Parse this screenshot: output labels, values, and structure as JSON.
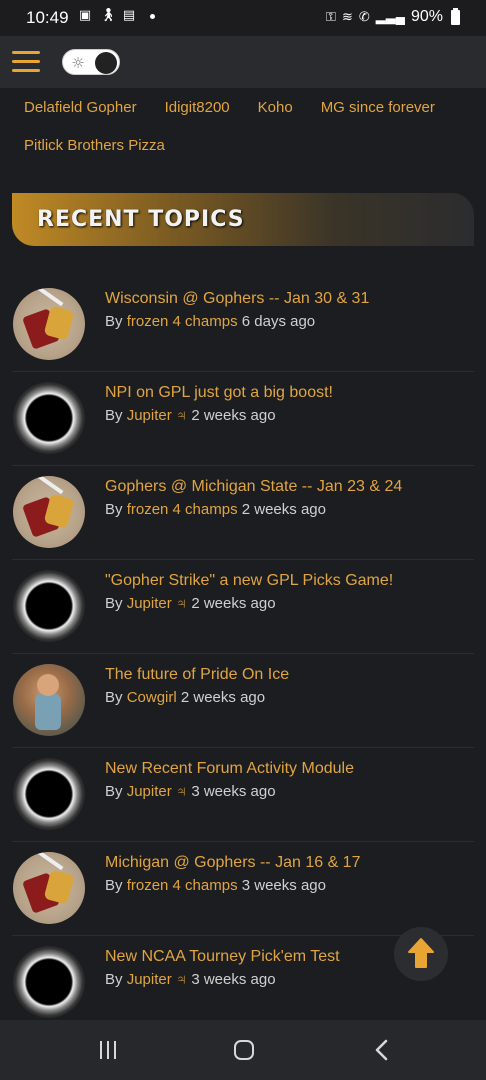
{
  "status_bar": {
    "time": "10:49",
    "battery": "90%"
  },
  "header": {
    "menu_icon": "hamburger-menu-icon",
    "theme_toggle_icon": "sun-icon"
  },
  "top_links": [
    [
      "Delafield Gopher",
      "Idigit8200",
      "Koho",
      "MG since forever"
    ],
    [
      "Pitlick Brothers Pizza"
    ]
  ],
  "recent_topics": {
    "heading": "RECENT TOPICS",
    "items": [
      {
        "title": "Wisconsin @ Gophers -- Jan 30 & 31",
        "by": "By",
        "author": "frozen 4 champs",
        "time": "6 days ago",
        "avatar": "gopher"
      },
      {
        "title": "NPI on GPL just got a big boost!",
        "by": "By",
        "author": "Jupiter ♃",
        "time": "2 weeks ago",
        "avatar": "eclipse"
      },
      {
        "title": "Gophers @ Michigan State -- Jan 23 & 24",
        "by": "By",
        "author": "frozen 4 champs",
        "time": "2 weeks ago",
        "avatar": "gopher"
      },
      {
        "title": "\"Gopher Strike\" a new GPL Picks Game!",
        "by": "By",
        "author": "Jupiter ♃",
        "time": "2 weeks ago",
        "avatar": "eclipse"
      },
      {
        "title": "The future of Pride On Ice",
        "by": "By",
        "author": "Cowgirl",
        "time": "2 weeks ago",
        "avatar": "cowgirl"
      },
      {
        "title": "New Recent Forum Activity Module",
        "by": "By",
        "author": "Jupiter ♃",
        "time": "3 weeks ago",
        "avatar": "eclipse"
      },
      {
        "title": "Michigan @ Gophers -- Jan 16 & 17",
        "by": "By",
        "author": "frozen 4 champs",
        "time": "3 weeks ago",
        "avatar": "gopher"
      },
      {
        "title": "New NCAA Tourney Pick'em Test",
        "by": "By",
        "author": "Jupiter ♃",
        "time": "3 weeks ago",
        "avatar": "eclipse"
      }
    ]
  },
  "colors": {
    "accent": "#e0a542",
    "background": "#1c1d20"
  }
}
